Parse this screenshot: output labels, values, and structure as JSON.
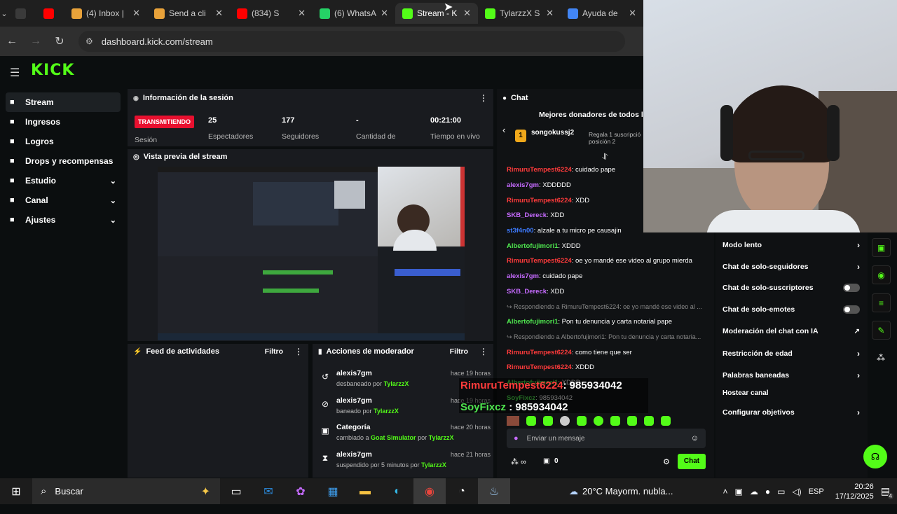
{
  "browser": {
    "tabs": [
      {
        "title": "",
        "icon": "settings-icon",
        "color": "#3a3a3a"
      },
      {
        "title": "",
        "icon": "youtube-icon",
        "color": "#ff0000"
      },
      {
        "title": "(4) Inbox |",
        "icon": "mail-icon",
        "color": "#e8a23a"
      },
      {
        "title": "Send a cli",
        "icon": "app-icon",
        "color": "#e8a23a"
      },
      {
        "title": "(834) S",
        "icon": "youtube-icon",
        "color": "#ff0000"
      },
      {
        "title": "(6) WhatsA",
        "icon": "whatsapp-icon",
        "color": "#25d366"
      },
      {
        "title": "Stream - K",
        "icon": "kick-icon",
        "color": "#53fc18"
      },
      {
        "title": "TylarzzX S",
        "icon": "kick-icon",
        "color": "#53fc18"
      },
      {
        "title": "Ayuda de",
        "icon": "google-icon",
        "color": "#4285f4"
      }
    ],
    "url": "dashboard.kick.com/stream"
  },
  "app": {
    "logo": "KICK",
    "nav": [
      {
        "label": "Stream",
        "icon": "stream-icon",
        "active": true,
        "chevron": false
      },
      {
        "label": "Ingresos",
        "icon": "revenue-icon",
        "active": false,
        "chevron": false
      },
      {
        "label": "Logros",
        "icon": "trophy-icon",
        "active": false,
        "chevron": false
      },
      {
        "label": "Drops y recompensas",
        "icon": "gift-icon",
        "active": false,
        "chevron": false
      },
      {
        "label": "Estudio",
        "icon": "studio-icon",
        "active": false,
        "chevron": true
      },
      {
        "label": "Canal",
        "icon": "channel-icon",
        "active": false,
        "chevron": true
      },
      {
        "label": "Ajustes",
        "icon": "gear-icon",
        "active": false,
        "chevron": true
      }
    ]
  },
  "session": {
    "title": "Información de la sesión",
    "live_badge": "TRANSMITIENDO",
    "session_label": "Sesión",
    "stats": [
      {
        "value": "25",
        "label": "Espectadores"
      },
      {
        "value": "177",
        "label": "Seguidores"
      },
      {
        "value": "-",
        "label": "Cantidad de"
      },
      {
        "value": "00:21:00",
        "label": "Tiempo en vivo"
      }
    ]
  },
  "preview": {
    "title": "Vista previa del stream"
  },
  "feed": {
    "title": "Feed de actividades",
    "filter": "Filtro"
  },
  "mod": {
    "title": "Acciones de moderador",
    "filter": "Filtro",
    "rows": [
      {
        "icon": "undo-icon",
        "name": "alexis7gm",
        "desc_pre": "desbaneado por",
        "desc_user": "TylarzzX",
        "time": "hace 19 horas"
      },
      {
        "icon": "ban-icon",
        "name": "alexis7gm",
        "desc_pre": "baneado por",
        "desc_user": "TylarzzX",
        "time": "hace 19 horas"
      },
      {
        "icon": "category-icon",
        "name": "Categoría",
        "desc_pre": "cambiado a",
        "desc_mid": "Goat Simulator",
        "desc_post": "por",
        "desc_user": "TylarzzX",
        "time": "hace 20 horas"
      },
      {
        "icon": "hourglass-icon",
        "name": "alexis7gm",
        "desc_pre": "suspendido por 5 minutos por",
        "desc_user": "TylarzzX",
        "time": "hace 21 horas"
      }
    ]
  },
  "chat": {
    "title": "Chat",
    "donors_title": "Mejores donadores de todos los",
    "donor_name": "songokussj2",
    "donor_rank": "1",
    "donor_gift": "Regala 1 suscripció",
    "donor_pos": "posición 2",
    "messages": [
      {
        "type": "msg",
        "user": "RimuruTempest6224",
        "color": "red",
        "text": ": cuidado pape"
      },
      {
        "type": "msg",
        "user": "alexis7gm",
        "color": "purp",
        "text": ": XDDDDD"
      },
      {
        "type": "msg",
        "user": "RimuruTempest6224",
        "color": "red",
        "text": ": XDD"
      },
      {
        "type": "msg",
        "user": "SKB_Dereck",
        "color": "purp",
        "text": ": XDD"
      },
      {
        "type": "msg",
        "user": "st3f4n00",
        "color": "blue",
        "text": ": alzale a tu micro pe causajin"
      },
      {
        "type": "msg",
        "user": "Albertofujimori1",
        "color": "grn",
        "text": ": XDDD"
      },
      {
        "type": "msg",
        "user": "RimuruTempest6224",
        "color": "red",
        "text": ": oe yo mandé ese video al grupo mierda"
      },
      {
        "type": "msg",
        "user": "alexis7gm",
        "color": "purp",
        "text": ": cuidado pape"
      },
      {
        "type": "msg",
        "user": "SKB_Dereck",
        "color": "purp",
        "text": ": XDD"
      },
      {
        "type": "reply",
        "text": "↪ Respondiendo a RimuruTempest6224: oe yo mandé ese video al ..."
      },
      {
        "type": "msg",
        "user": "Albertofujimori1",
        "color": "grn",
        "text": ": Pon tu denuncia y carta notarial pape"
      },
      {
        "type": "reply",
        "text": "↪ Respondiendo a Albertofujimori1: Pon tu denuncia y carta notaria..."
      },
      {
        "type": "msg",
        "user": "RimuruTempest6224",
        "color": "red",
        "text": ": como tiene que ser"
      },
      {
        "type": "msg",
        "user": "RimuruTempest6224",
        "color": "red",
        "text": ": XDDD"
      },
      {
        "type": "msg",
        "user": "Albertofujimori1",
        "color": "grn",
        "text": ": XDDD"
      },
      {
        "type": "msg",
        "user": "SoyFixcz",
        "color": "grn",
        "text": ": 985934042"
      }
    ],
    "overlay1_user": "RimuruTempest6224",
    "overlay1_text": ": 985934042",
    "overlay2_user": "SoyFixcz",
    "overlay2_text": " : 985934042",
    "input_placeholder": "Enviar un mensaje",
    "points": "0",
    "send_label": "Chat"
  },
  "settings_menu": [
    {
      "label": "Modo lento",
      "kind": "arrow"
    },
    {
      "label": "Chat de solo-seguidores",
      "kind": "arrow"
    },
    {
      "label": "Chat de solo-suscriptores",
      "kind": "toggle"
    },
    {
      "label": "Chat de solo-emotes",
      "kind": "toggle"
    },
    {
      "label": "Moderación del chat con IA",
      "kind": "external"
    },
    {
      "label": "Restricción de edad",
      "kind": "arrow"
    },
    {
      "label": "Palabras baneadas",
      "kind": "arrow"
    },
    {
      "label": "Hostear canal",
      "kind": "none"
    },
    {
      "label": "Configurar objetivos",
      "kind": "arrow"
    }
  ],
  "taskbar": {
    "search": "Buscar",
    "weather": "20°C  Mayorm. nubla...",
    "lang": "ESP",
    "time": "20:26",
    "date": "17/12/2025",
    "notif_count": "4"
  },
  "colors": {
    "kick_green": "#53fc18",
    "live_red": "#e8102f",
    "panel": "#191b1f"
  }
}
